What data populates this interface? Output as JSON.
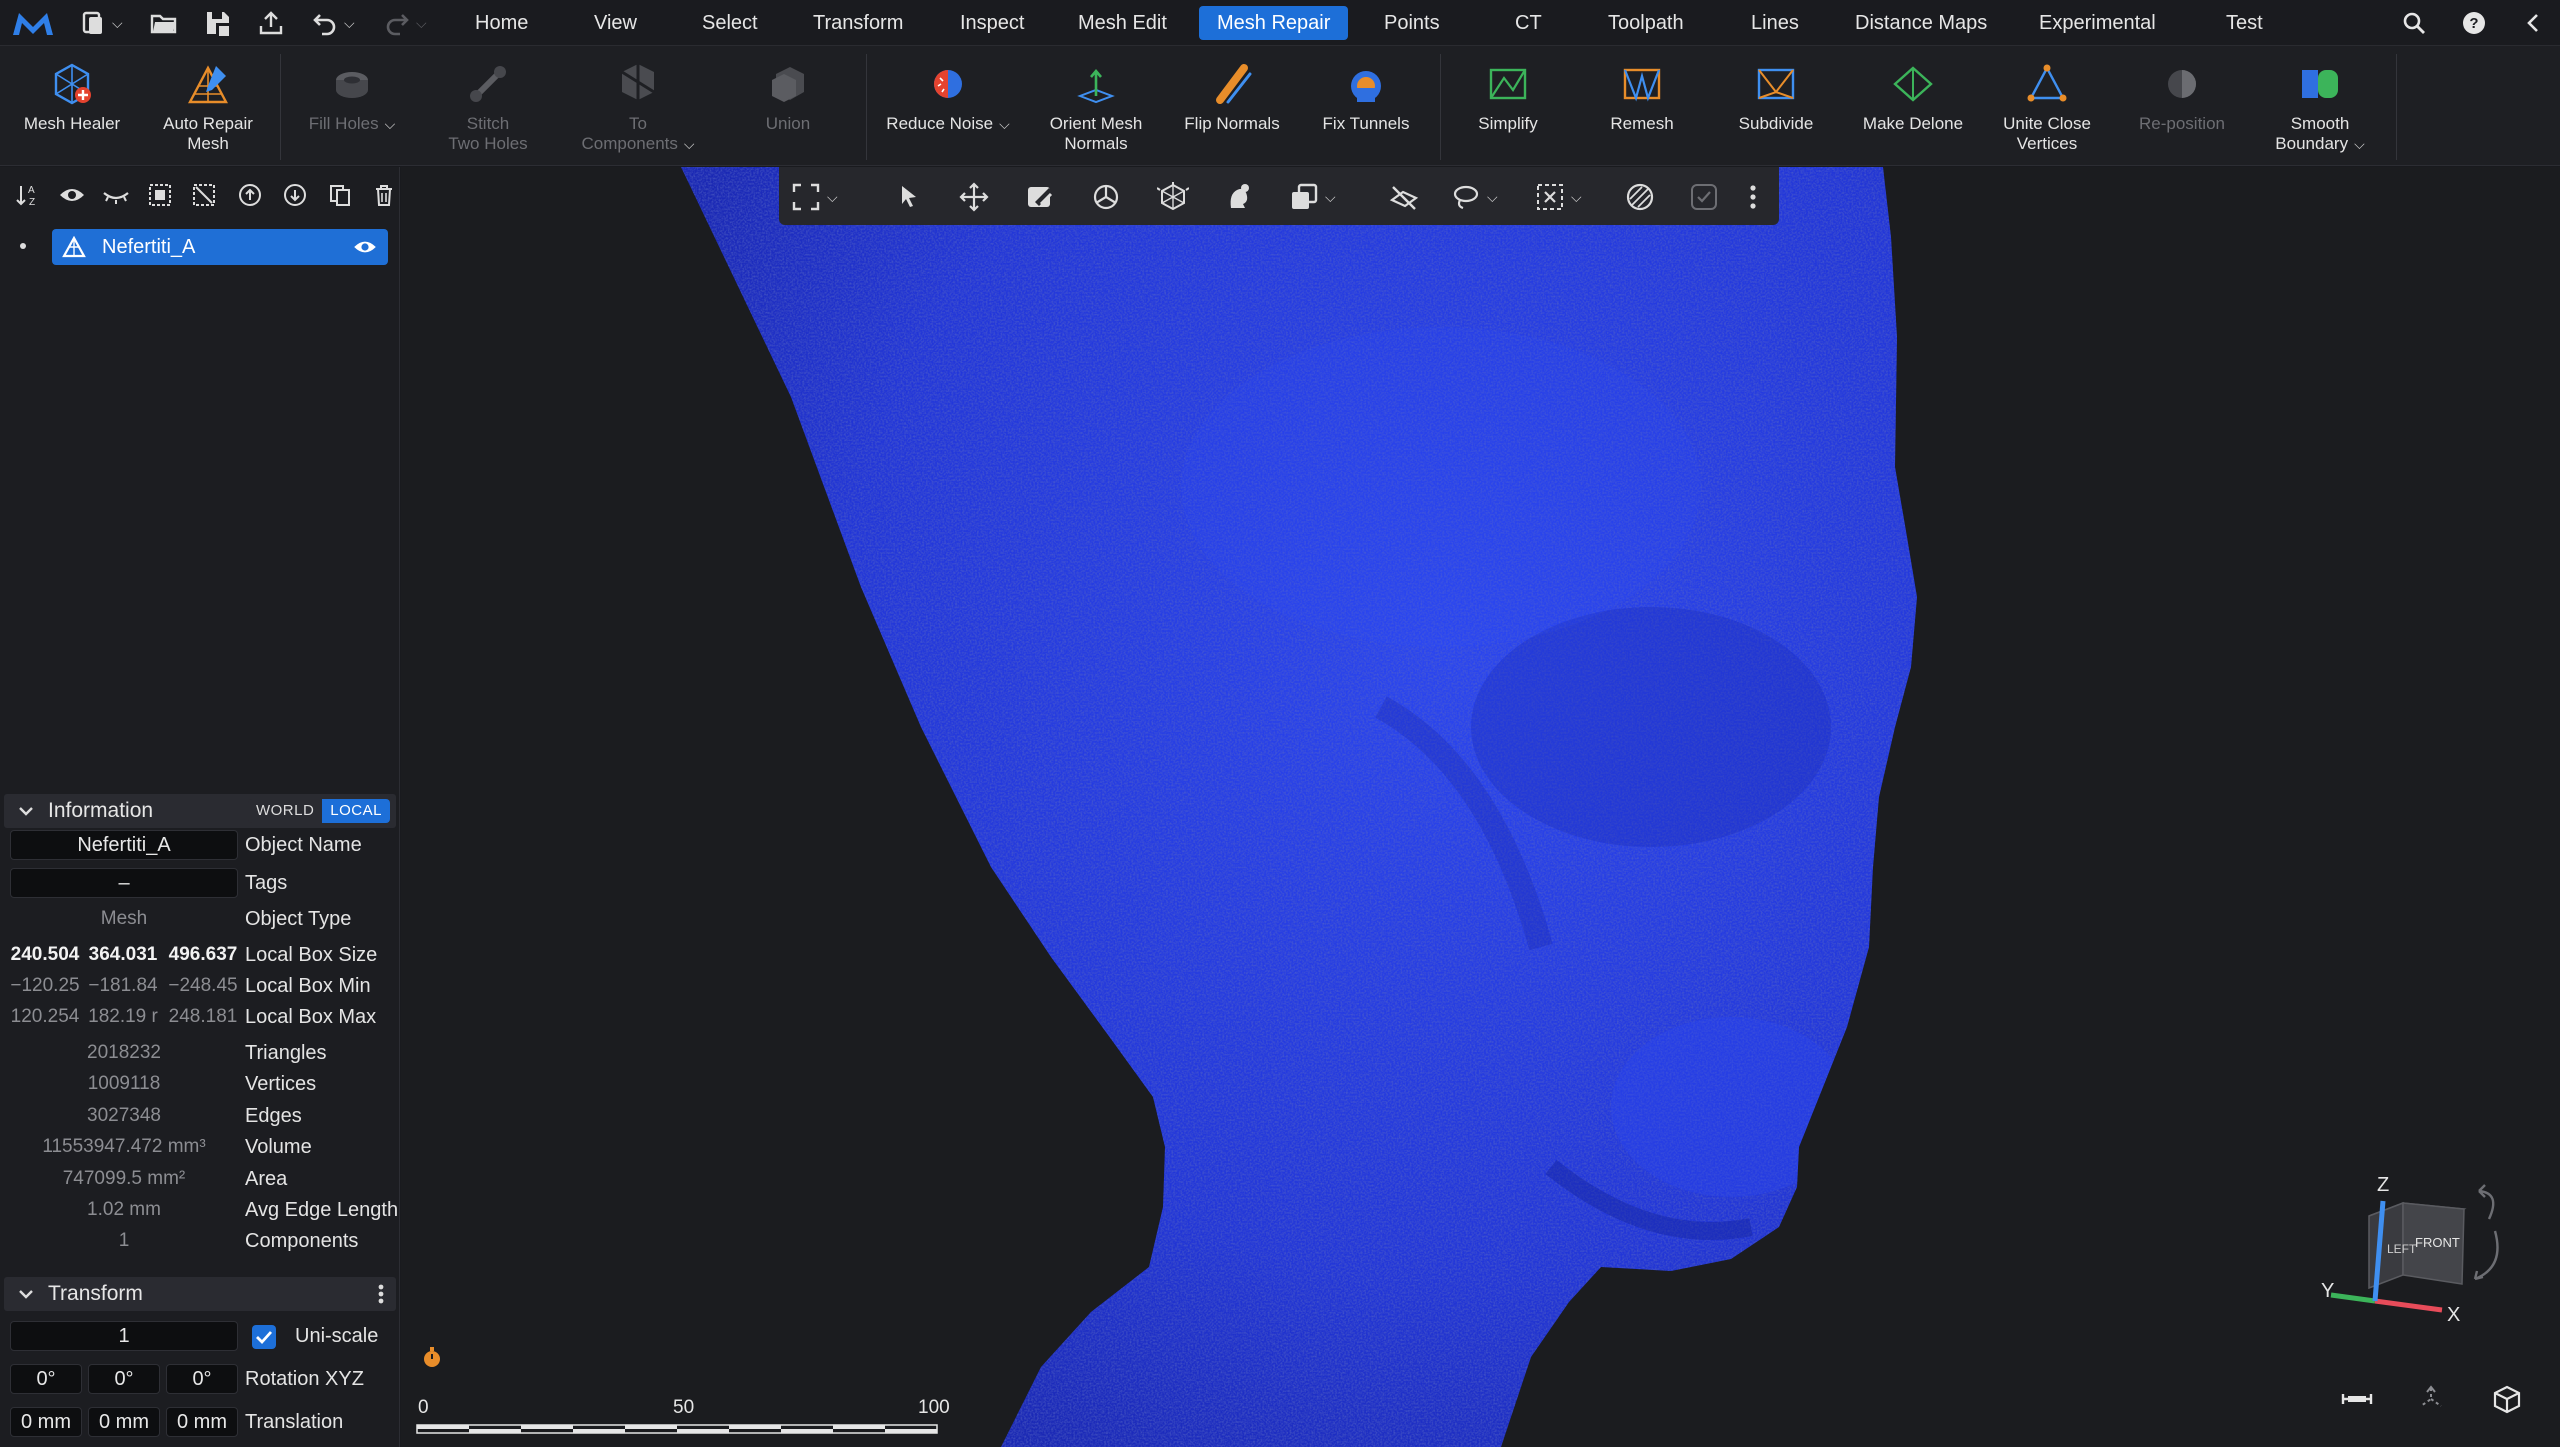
{
  "menu": {
    "tabs": [
      "Home",
      "View",
      "Select",
      "Transform",
      "Inspect",
      "Mesh Edit",
      "Mesh Repair",
      "Points",
      "CT",
      "Toolpath",
      "Lines",
      "Distance Maps",
      "Experimental",
      "Test"
    ],
    "active": "Mesh Repair"
  },
  "ribbon": {
    "mesh_healer": "Mesh Healer",
    "auto_repair": "Auto Repair\nMesh",
    "fill_holes": "Fill Holes",
    "stitch_holes": "Stitch\nTwo Holes",
    "to_components": "To\nComponents",
    "union": "Union",
    "reduce_noise": "Reduce Noise",
    "orient_normals": "Orient Mesh\nNormals",
    "flip_normals": "Flip Normals",
    "fix_tunnels": "Fix Tunnels",
    "simplify": "Simplify",
    "remesh": "Remesh",
    "subdivide": "Subdivide",
    "make_delone": "Make Delone",
    "unite_vertices": "Unite Close\nVertices",
    "reposition": "Re-position",
    "smooth_boundary": "Smooth\nBoundary"
  },
  "tree": {
    "object_name": "Nefertiti_A"
  },
  "information": {
    "title": "Information",
    "world": "WORLD",
    "local": "LOCAL",
    "object_name_value": "Nefertiti_A",
    "object_name_label": "Object Name",
    "tags_value": "–",
    "tags_label": "Tags",
    "object_type_value": "Mesh",
    "object_type_label": "Object Type",
    "box_size": [
      "240.504",
      "364.031",
      "496.637"
    ],
    "box_size_label": "Local Box Size",
    "box_min": [
      "−120.25",
      "−181.84",
      "−248.45"
    ],
    "box_min_label": "Local Box Min",
    "box_max": [
      "120.254",
      "182.19 r",
      "248.181"
    ],
    "box_max_label": "Local Box Max",
    "triangles_value": "2018232",
    "triangles_label": "Triangles",
    "vertices_value": "1009118",
    "vertices_label": "Vertices",
    "edges_value": "3027348",
    "edges_label": "Edges",
    "volume_value": "11553947.472 mm³",
    "volume_label": "Volume",
    "area_value": "747099.5 mm²",
    "area_label": "Area",
    "avg_edge_value": "1.02 mm",
    "avg_edge_label": "Avg Edge Length",
    "components_value": "1",
    "components_label": "Components"
  },
  "transform": {
    "title": "Transform",
    "scale_value": "1",
    "uniscale_label": "Uni-scale",
    "uniscale_checked": true,
    "rotation": [
      "0°",
      "0°",
      "0°"
    ],
    "rotation_label": "Rotation XYZ",
    "translation": [
      "0 mm",
      "0 mm",
      "0 mm"
    ],
    "translation_label": "Translation"
  },
  "scale_bar": {
    "ticks": [
      "0",
      "50",
      "100"
    ]
  },
  "view_cube": {
    "axis_x": "X",
    "axis_y": "Y",
    "axis_z": "Z",
    "face_left": "LEFT",
    "face_front": "FRONT"
  },
  "colors": {
    "accent": "#1d6fd8",
    "mesh": "#2437e0",
    "background": "#1b1c1f",
    "panel": "#1c1d21"
  }
}
